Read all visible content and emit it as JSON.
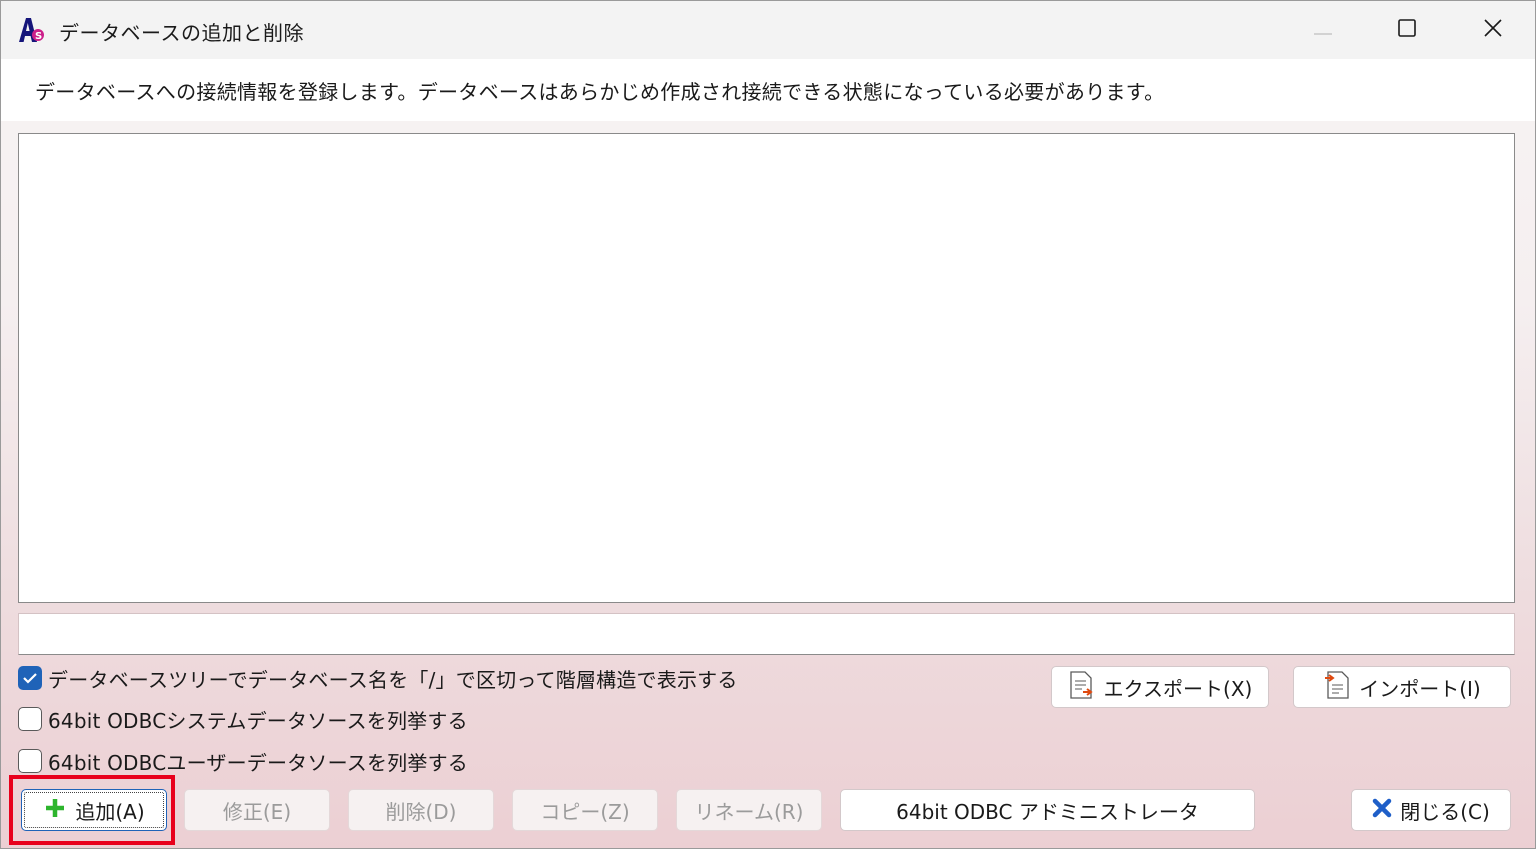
{
  "window": {
    "title": "データベースの追加と削除",
    "icon": "app-logo-icon"
  },
  "info_text": "データベースへの接続情報を登録します。データベースはあらかじめ作成され接続できる状態になっている必要があります。",
  "path_value": "",
  "checkboxes": [
    {
      "label": "データベースツリーでデータベース名を「/」で区切って階層構造で表示する",
      "checked": true
    },
    {
      "label": "64bit ODBCシステムデータソースを列挙する",
      "checked": false
    },
    {
      "label": "64bit ODBCユーザーデータソースを列挙する",
      "checked": false
    }
  ],
  "buttons": {
    "export": "エクスポート(X)",
    "import": "インポート(I)",
    "add": "追加(A)",
    "edit": "修正(E)",
    "delete": "削除(D)",
    "copy": "コピー(Z)",
    "rename": "リネーム(R)",
    "odbc_admin": "64bit ODBC アドミニストレータ",
    "close": "閉じる(C)"
  },
  "colors": {
    "accent": "#1f63b8",
    "add_icon": "#2db52d",
    "close_icon": "#1f5fc8",
    "highlight": "#e8001c"
  }
}
